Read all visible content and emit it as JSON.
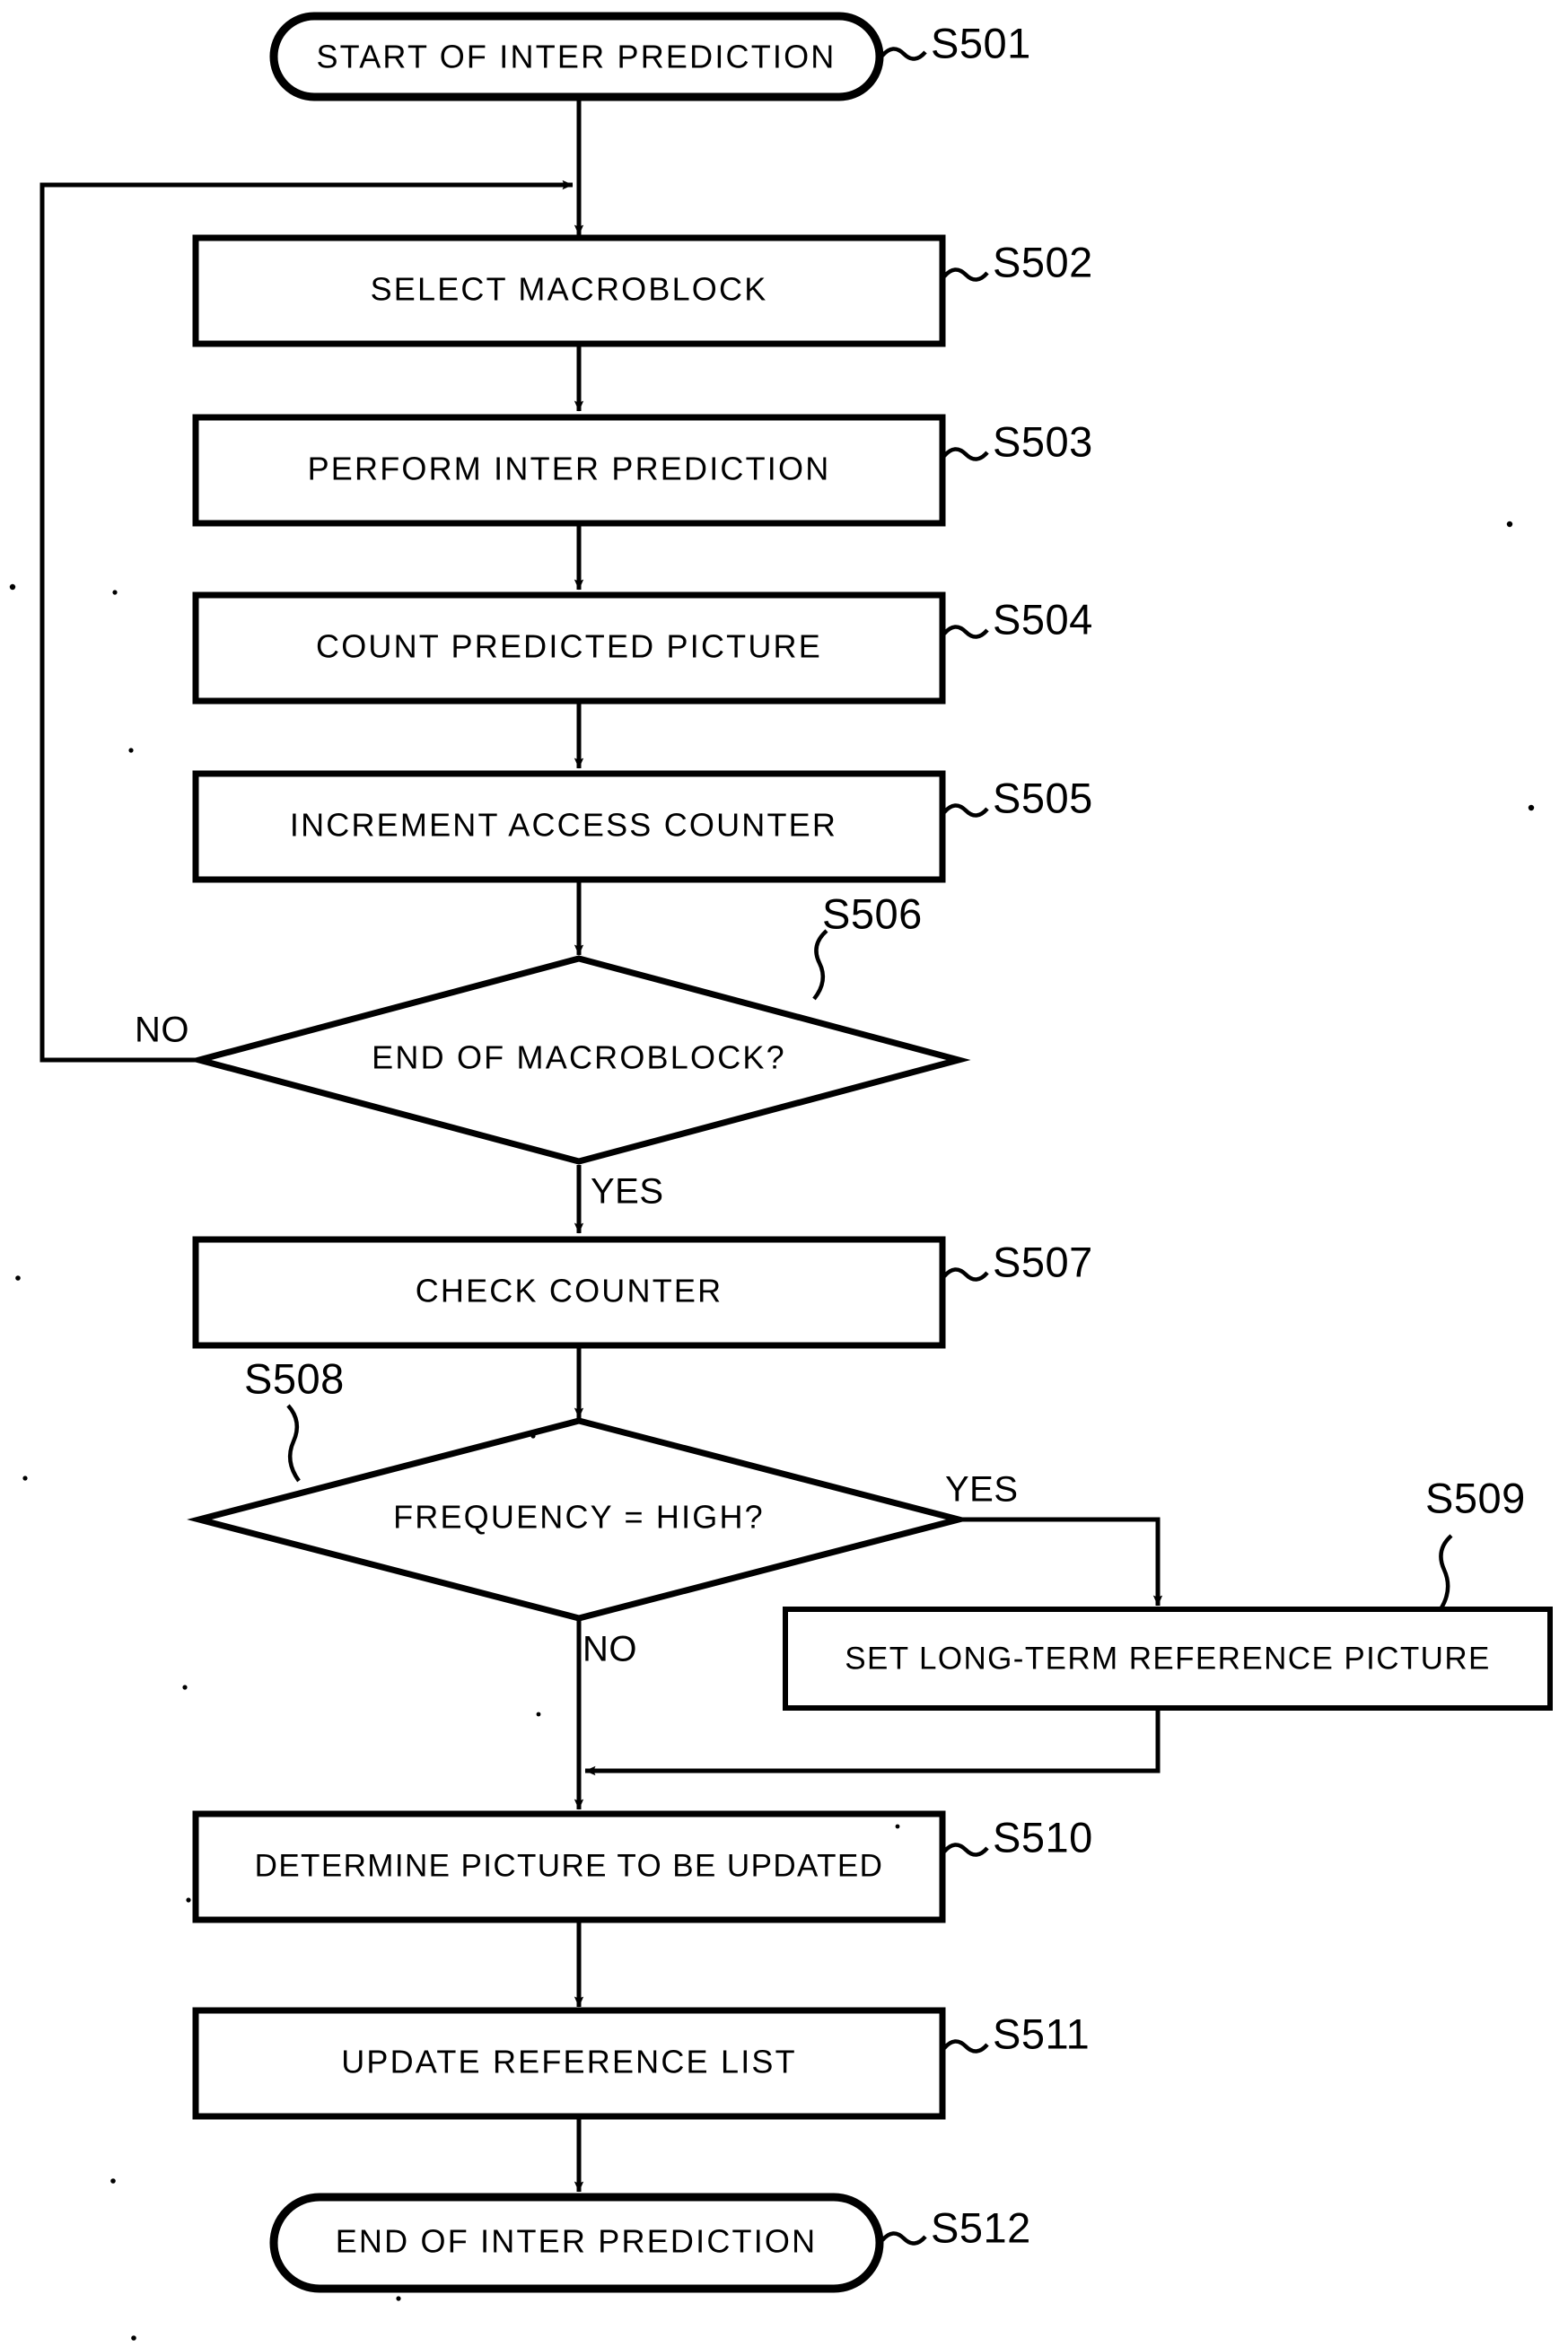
{
  "figure": {
    "kind": "flowchart",
    "orientation": "vertical",
    "background_color": "#ffffff",
    "line_color": "#000000"
  },
  "nodes": {
    "s501": {
      "label": "START OF INTER PREDICTION",
      "ref": "S501",
      "shape": "terminator"
    },
    "s502": {
      "label": "SELECT MACROBLOCK",
      "ref": "S502",
      "shape": "process"
    },
    "s503": {
      "label": "PERFORM INTER PREDICTION",
      "ref": "S503",
      "shape": "process"
    },
    "s504": {
      "label": "COUNT PREDICTED PICTURE",
      "ref": "S504",
      "shape": "process"
    },
    "s505": {
      "label": "INCREMENT ACCESS COUNTER",
      "ref": "S505",
      "shape": "process"
    },
    "s506": {
      "label": "END OF MACROBLOCK?",
      "ref": "S506",
      "shape": "decision"
    },
    "s507": {
      "label": "CHECK COUNTER",
      "ref": "S507",
      "shape": "process"
    },
    "s508": {
      "label": "FREQUENCY = HIGH?",
      "ref": "S508",
      "shape": "decision"
    },
    "s509": {
      "label": "SET LONG-TERM REFERENCE PICTURE",
      "ref": "S509",
      "shape": "process"
    },
    "s510": {
      "label": "DETERMINE PICTURE TO BE UPDATED",
      "ref": "S510",
      "shape": "process"
    },
    "s511": {
      "label": "UPDATE REFERENCE LIST",
      "ref": "S511",
      "shape": "process"
    },
    "s512": {
      "label": "END OF INTER PREDICTION",
      "ref": "S512",
      "shape": "terminator"
    }
  },
  "branch_labels": {
    "s506_no": "NO",
    "s506_yes": "YES",
    "s508_yes": "YES",
    "s508_no": "NO"
  },
  "edges": [
    {
      "from": "s501",
      "to": "s502",
      "label": ""
    },
    {
      "from": "s502",
      "to": "s503",
      "label": ""
    },
    {
      "from": "s503",
      "to": "s504",
      "label": ""
    },
    {
      "from": "s504",
      "to": "s505",
      "label": ""
    },
    {
      "from": "s505",
      "to": "s506",
      "label": ""
    },
    {
      "from": "s506",
      "to": "s502",
      "label": "NO"
    },
    {
      "from": "s506",
      "to": "s507",
      "label": "YES"
    },
    {
      "from": "s507",
      "to": "s508",
      "label": ""
    },
    {
      "from": "s508",
      "to": "s509",
      "label": "YES"
    },
    {
      "from": "s508",
      "to": "s510",
      "label": "NO"
    },
    {
      "from": "s509",
      "to": "s510",
      "label": ""
    },
    {
      "from": "s510",
      "to": "s511",
      "label": ""
    },
    {
      "from": "s511",
      "to": "s512",
      "label": ""
    }
  ]
}
